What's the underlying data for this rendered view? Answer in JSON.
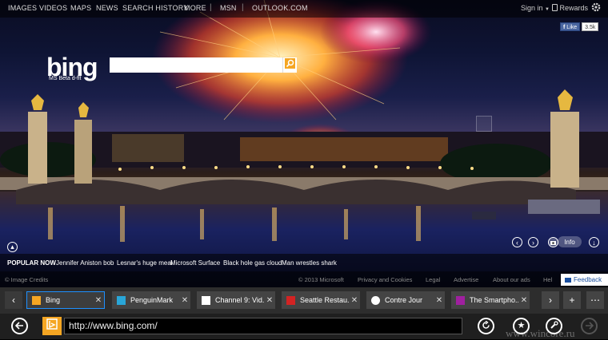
{
  "topnav": {
    "links": [
      "IMAGES",
      "VIDEOS",
      "MAPS",
      "NEWS",
      "SEARCH HISTORY",
      "MORE",
      "MSN",
      "OUTLOOK.COM"
    ],
    "separator": "|",
    "signin": "Sign in",
    "rewards": "Rewards"
  },
  "facebook": {
    "like_label": "Like",
    "count": "3.5k"
  },
  "logo": {
    "text": "bing",
    "subtitle": "MS Beta d-flt"
  },
  "search": {
    "value": "",
    "placeholder": ""
  },
  "image_controls": {
    "info_label": "Info"
  },
  "popular_now": {
    "heading": "POPULAR NOW",
    "items": [
      "Jennifer Aniston bob",
      "Lesnar's huge meal",
      "Microsoft Surface",
      "Black hole gas cloud",
      "Man wrestles shark"
    ]
  },
  "footer": {
    "credits": "© Image Credits",
    "links": [
      "© 2013 Microsoft",
      "Privacy and Cookies",
      "Legal",
      "Advertise",
      "About our ads",
      "Hel"
    ],
    "feedback": "Feedback"
  },
  "tabs": [
    {
      "title": "Bing",
      "icon": "bing-favicon-icon",
      "color": "#f5a623",
      "active": true
    },
    {
      "title": "PenguinMark",
      "icon": "penguinmark-favicon-icon",
      "color": "#29a6d8",
      "active": false
    },
    {
      "title": "Channel 9: Vid...",
      "icon": "channel9-favicon-icon",
      "color": "#ffffff",
      "active": false
    },
    {
      "title": "Seattle Restau...",
      "icon": "yelp-favicon-icon",
      "color": "#d32323",
      "active": false
    },
    {
      "title": "Contre Jour",
      "icon": "contrejour-favicon-icon",
      "color": "#ffffff",
      "active": false
    },
    {
      "title": "The Smartpho...",
      "icon": "smartphone-favicon-icon",
      "color": "#a020a0",
      "active": false
    }
  ],
  "tab_close_glyph": "✕",
  "address": {
    "url": "http://www.bing.com/"
  },
  "watermark": "www.wincore.ru",
  "colors": {
    "tab_active_border": "#1e90ff",
    "bing_orange": "#f5a623"
  }
}
